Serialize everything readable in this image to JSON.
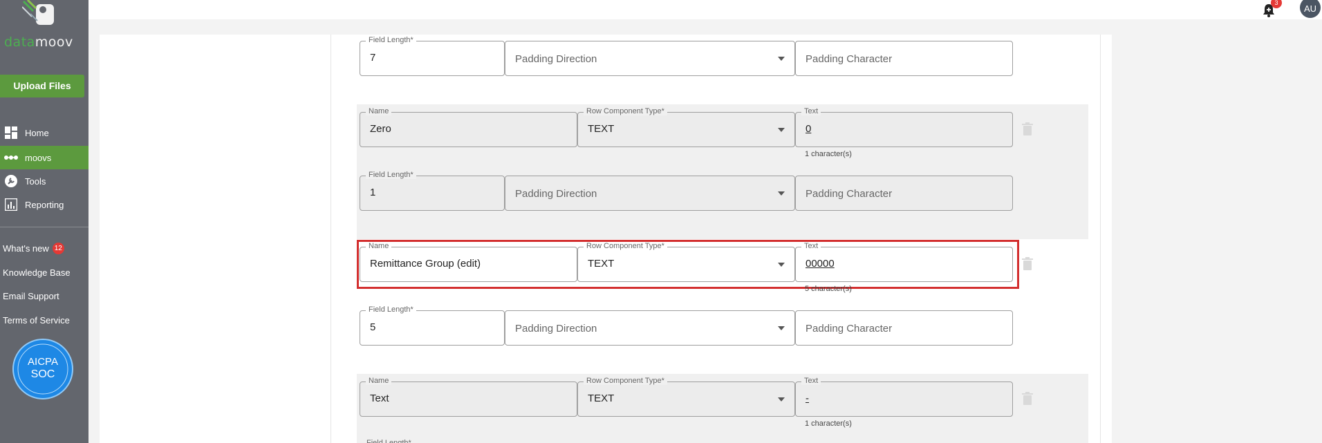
{
  "sidebar": {
    "logo_text_green": "data",
    "logo_text_white": "moov",
    "upload_label": "Upload Files",
    "nav": [
      {
        "label": "Home",
        "icon": "dashboard-icon"
      },
      {
        "label": "moovs",
        "icon": "dots-icon",
        "active": true
      },
      {
        "label": "Tools",
        "icon": "wrench-icon"
      },
      {
        "label": "Reporting",
        "icon": "chart-icon"
      }
    ],
    "links": {
      "whats_new": "What's new",
      "whats_new_count": "12",
      "knowledge_base": "Knowledge Base",
      "email_support": "Email Support",
      "terms": "Terms of Service"
    },
    "soc_badge": {
      "line1": "AICPA",
      "line2": "SOC"
    }
  },
  "topbar": {
    "notification_count": "3",
    "avatar_initials": "AU"
  },
  "form": {
    "labels": {
      "name": "Name",
      "row_component_type": "Row Component Type*",
      "text": "Text",
      "field_length": "Field Length*",
      "padding_direction": "Padding Direction",
      "padding_character": "Padding Character"
    },
    "rows": [
      {
        "field_length": "7"
      },
      {
        "name": "Zero",
        "type": "TEXT",
        "text": "0",
        "helper": "1 character(s)",
        "field_length": "1"
      },
      {
        "name": "Remittance Group (edit)",
        "type": "TEXT",
        "text": "00000",
        "helper": "5 character(s)",
        "field_length": "5"
      },
      {
        "name": "Text",
        "type": "TEXT",
        "text": "-",
        "helper": "1 character(s)"
      }
    ]
  },
  "colors": {
    "sidebar_bg": "#63666d",
    "accent_green": "#5c9a3e",
    "highlight_red": "#d32f2f"
  }
}
